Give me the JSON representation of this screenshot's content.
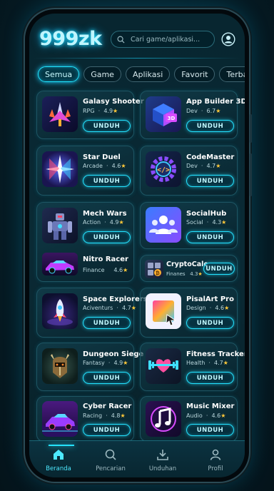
{
  "header": {
    "logo": "999zk",
    "search_placeholder": "Cari game/aplikasi..."
  },
  "tabs": [
    {
      "label": "Semua",
      "active": true
    },
    {
      "label": "Game"
    },
    {
      "label": "Aplikasi"
    },
    {
      "label": "Favorit"
    },
    {
      "label": "Terbaru"
    }
  ],
  "download_label": "UNDUH",
  "apps": [
    {
      "name": "Galasy Shooter",
      "category": "RPG",
      "rating": "4.9",
      "icon": "space-shooter-icon"
    },
    {
      "name": "App Builder 3D",
      "category": "Dev",
      "rating": "6.7",
      "icon": "3d-cube-icon"
    },
    {
      "name": "Star Duel",
      "category": "Arcade",
      "rating": "4.6",
      "icon": "star-burst-icon"
    },
    {
      "name": "CodeMaster",
      "category": "Dev",
      "rating": "4.7",
      "icon": "code-gear-icon"
    },
    {
      "name": "Mech Wars",
      "category": "Action",
      "rating": "4.9",
      "icon": "mech-robot-icon"
    },
    {
      "name": "SocialHub",
      "category": "Social",
      "rating": "4.3",
      "icon": "people-icon"
    },
    {
      "name": "Nitro Racer",
      "category": "Finance",
      "rating": "4.6",
      "icon": "race-car-icon"
    },
    {
      "name": "CryptoCalc",
      "category": "Finanes",
      "rating": "4.3",
      "icon": "calculator-icon"
    },
    {
      "name": "Space Explorers",
      "category": "Aciventurs",
      "rating": "4.7",
      "icon": "rocket-icon"
    },
    {
      "name": "PisalArt Pro",
      "category": "Design",
      "rating": "4.6",
      "icon": "pixel-art-icon"
    },
    {
      "name": "Dungeon Siege",
      "category": "Fantasy",
      "rating": "4.9",
      "icon": "knight-helmet-icon"
    },
    {
      "name": "Fitness Tracker",
      "category": "Health",
      "rating": "4.7",
      "icon": "heart-dumbbell-icon"
    },
    {
      "name": "Cyber Racer",
      "category": "Racing",
      "rating": "4.8",
      "icon": "cyber-car-icon"
    },
    {
      "name": "Music Mixer",
      "category": "Audio",
      "rating": "4.6",
      "icon": "music-note-icon"
    }
  ],
  "nav": [
    {
      "label": "Beranda",
      "icon": "home-icon",
      "active": true
    },
    {
      "label": "Pencarian",
      "icon": "search-icon"
    },
    {
      "label": "Unduhan",
      "icon": "download-icon"
    },
    {
      "label": "Profil",
      "icon": "user-icon"
    }
  ],
  "colors": {
    "accent": "#25e2ff",
    "star": "#ffc93a",
    "background": "#082630"
  }
}
